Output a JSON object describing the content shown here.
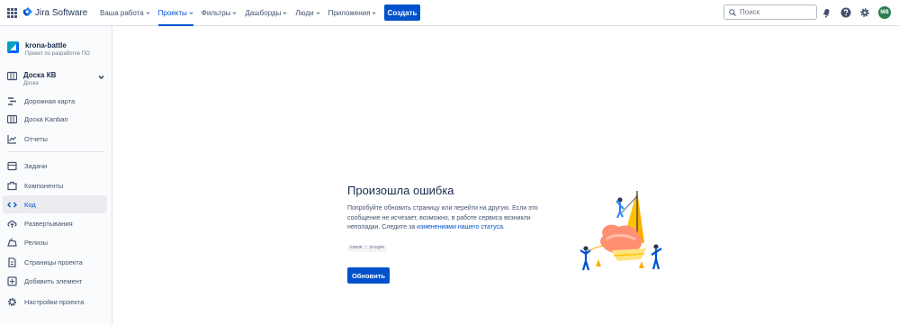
{
  "topnav": {
    "app_name": "Jira Software",
    "menu": [
      {
        "label": "Ваша работа"
      },
      {
        "label": "Проекты"
      },
      {
        "label": "Фильтры"
      },
      {
        "label": "Дашборды"
      },
      {
        "label": "Люди"
      },
      {
        "label": "Приложения"
      }
    ],
    "create_label": "Создать",
    "search_placeholder": "Поиск",
    "avatar_initials": "МВ",
    "icons": [
      "app-switcher-icon",
      "notifications-icon",
      "help-icon",
      "settings-icon",
      "search-icon"
    ]
  },
  "sidebar": {
    "project_name": "krona-battle",
    "project_type": "Проект по разработке ПО",
    "board_name": "Доска КВ",
    "board_type": "Доска",
    "items": [
      {
        "label": "Дорожная карта",
        "icon": "roadmap-icon"
      },
      {
        "label": "Доска Kanban",
        "icon": "board-icon"
      },
      {
        "label": "Отчеты",
        "icon": "reports-icon"
      },
      {
        "label": "Задачи",
        "icon": "issues-icon"
      },
      {
        "label": "Компоненты",
        "icon": "components-icon"
      },
      {
        "label": "Код",
        "icon": "code-icon"
      },
      {
        "label": "Развертывания",
        "icon": "deployments-icon"
      },
      {
        "label": "Релизы",
        "icon": "releases-icon"
      },
      {
        "label": "Страницы проекта",
        "icon": "pages-icon"
      },
      {
        "label": "Добавить элемент",
        "icon": "add-item-icon"
      },
      {
        "label": "Настройки проекта",
        "icon": "settings-icon"
      }
    ]
  },
  "error": {
    "title": "Произошла ошибка",
    "text": "Попробуйте обновить страницу или перейти на другую. Если это сообщение не исчезает, возможно, в работе сервиса возникли неполадки. Следите за",
    "link_text": "изменениями нашего статуса.",
    "code": "ERROR : DA5Q0M",
    "refresh_label": "Обновить"
  },
  "colors": {
    "accent": "#0052cc",
    "text": "#172b4d",
    "subtle": "#42526e",
    "sidebar_bg": "#fafbfc",
    "active_bg": "#ebecf0"
  }
}
